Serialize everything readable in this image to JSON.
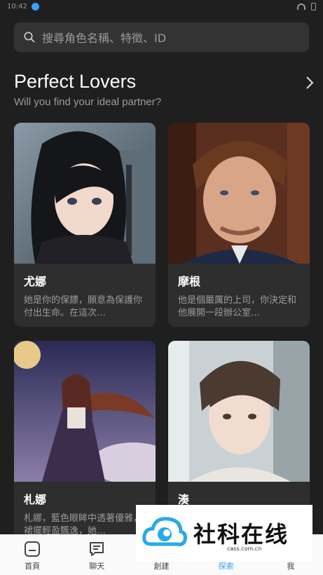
{
  "status_bar": {
    "time": "10:42"
  },
  "search": {
    "placeholder": "搜尋角色名稱、特徵、ID"
  },
  "section": {
    "title": "Perfect Lovers",
    "subtitle": "Will you find your ideal partner?"
  },
  "cards": [
    {
      "name": "尤娜",
      "desc": "她是你的保鏢，願意為保護你付出生命。在這次…"
    },
    {
      "name": "摩根",
      "desc": "他是個嚴厲的上司，你決定和他展開一段辦公室…"
    },
    {
      "name": "札娜",
      "desc": "札娜，藍色眼眸中透著優雅，裙擺輕盈飄逸，她…"
    },
    {
      "name": "湊",
      "desc": ""
    }
  ],
  "nav": [
    {
      "label": "首頁",
      "icon": "home-icon"
    },
    {
      "label": "聊天",
      "icon": "chat-icon"
    },
    {
      "label": "創建",
      "icon": "create-icon"
    },
    {
      "label": "探索",
      "icon": "explore-icon"
    },
    {
      "label": "我",
      "icon": "profile-icon"
    }
  ],
  "watermark": {
    "text": "社科在线",
    "url": "cass.com.cn"
  },
  "colors": {
    "background": "#1f1f1f",
    "card": "#2e2e2e",
    "accent": "#3aa0ff"
  }
}
